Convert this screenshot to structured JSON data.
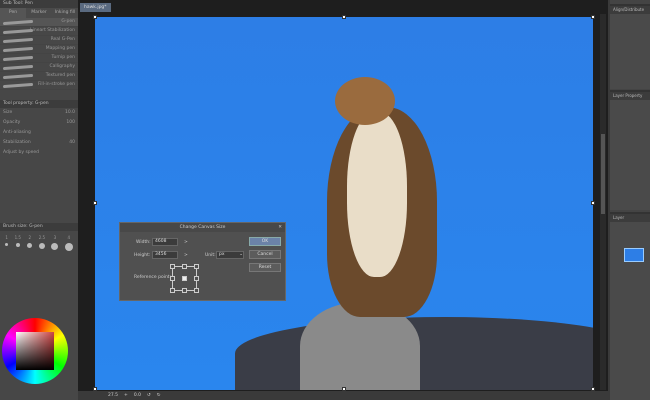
{
  "left_panel": {
    "subtool_title": "Sub Tool: Pen",
    "tabs": [
      "Marker",
      "Inking fill"
    ],
    "active_tab": "Pen",
    "brushes": [
      "G-pen",
      "Lineart Stabilization",
      "Real G-Pen",
      "Mapping pen",
      "Turnip pen",
      "Calligraphy",
      "Textured pen",
      "Fill-in-stroke pen"
    ],
    "tool_property_title": "Tool property: G-pen",
    "props": [
      {
        "label": "Size",
        "value": "10.0"
      },
      {
        "label": "Opacity",
        "value": "100"
      },
      {
        "label": "Anti-aliasing",
        "value": ""
      },
      {
        "label": "Stabilization",
        "value": "40"
      },
      {
        "label": "Adjust by speed",
        "value": ""
      }
    ],
    "brush_size_title": "Brush size: G-pen",
    "brush_sizes": [
      "1",
      "1.5",
      "2",
      "2.5",
      "3",
      "4"
    ]
  },
  "document": {
    "tab": "hawk.jpg*"
  },
  "dialog": {
    "title": "Change Canvas Size",
    "width_label": "Width:",
    "width_value": "4608",
    "height_label": "Height:",
    "height_value": "3456",
    "unit_label": "Unit:",
    "unit_value": "px",
    "reference_label": "Reference point:",
    "ok": "OK",
    "cancel": "Cancel",
    "reset": "Reset"
  },
  "status_bar": {
    "zoom": "27.5",
    "angle": "0.0"
  },
  "right_panel": {
    "panels": [
      "Align/Distribute",
      "Layer Property",
      "Layer"
    ]
  },
  "colors": {
    "sky": "#2d7ee6",
    "accent": "#6b82a8"
  }
}
